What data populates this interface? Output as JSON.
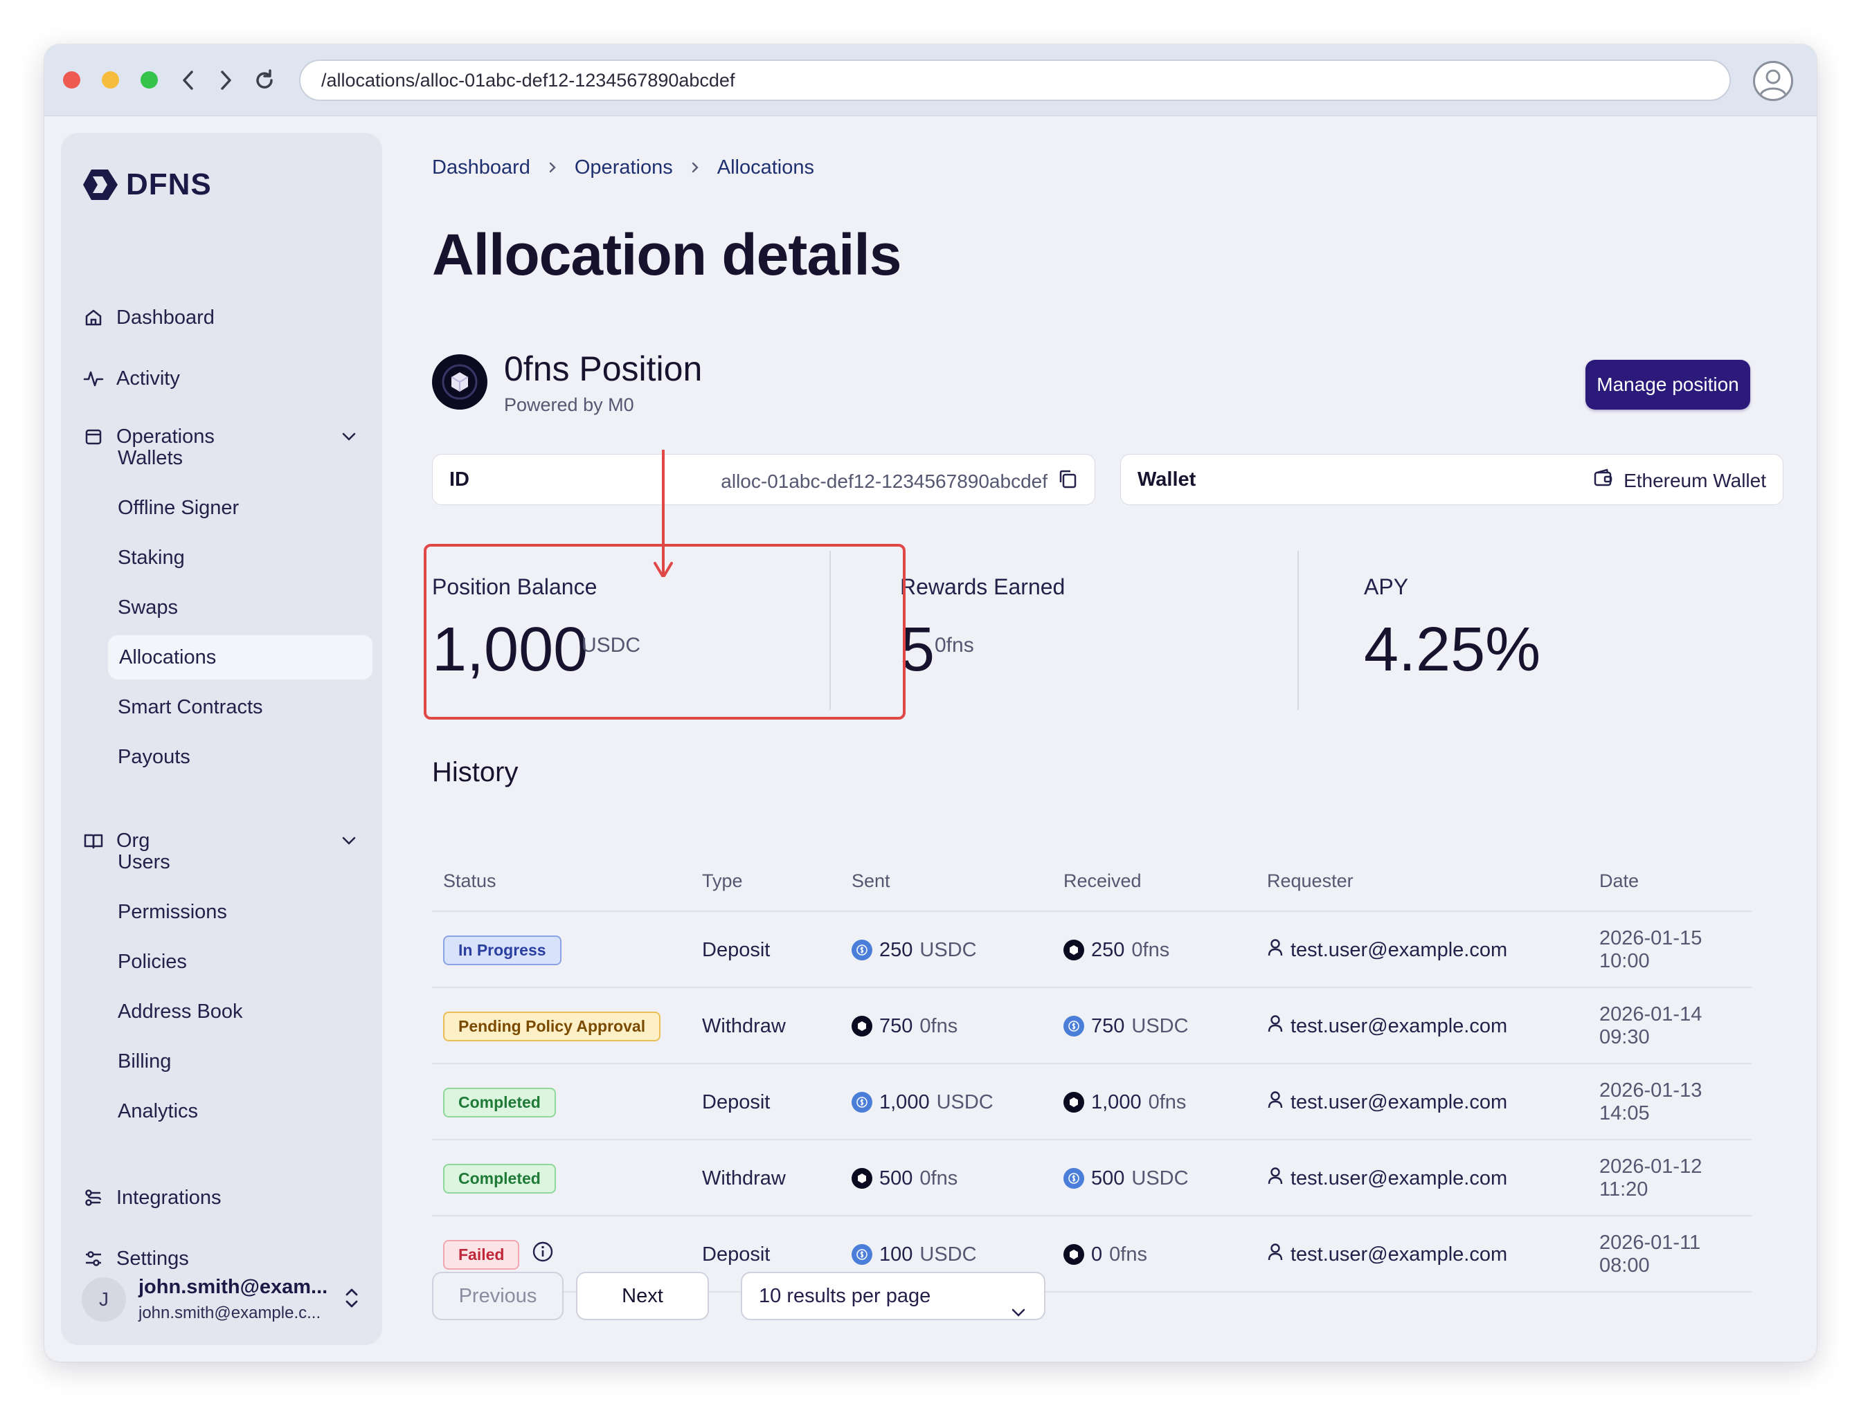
{
  "browser": {
    "url": "/allocations/alloc-01abc-def12-1234567890abcdef"
  },
  "sidebar": {
    "logo": "DFNS",
    "dashboard": "Dashboard",
    "activity": "Activity",
    "operations": "Operations",
    "operations_items": [
      "Wallets",
      "Offline Signer",
      "Staking",
      "Swaps",
      "Allocations",
      "Smart Contracts",
      "Payouts"
    ],
    "org": "Org",
    "org_items": [
      "Users",
      "Permissions",
      "Policies",
      "Address Book",
      "Billing",
      "Analytics"
    ],
    "integrations": "Integrations",
    "settings": "Settings",
    "user": {
      "initial": "J",
      "name": "john.smith@exam...",
      "email": "john.smith@example.c..."
    }
  },
  "breadcrumb": [
    "Dashboard",
    "Operations",
    "Allocations"
  ],
  "page_title": "Allocation details",
  "position": {
    "title": "0fns Position",
    "subtitle": "Powered by M0",
    "manage_label": "Manage position"
  },
  "id_card": {
    "label": "ID",
    "value": "alloc-01abc-def12-1234567890abcdef"
  },
  "wallet_card": {
    "label": "Wallet",
    "value": "Ethereum Wallet"
  },
  "stats": {
    "balance": {
      "label": "Position Balance",
      "value": "1,000",
      "unit": "USDC"
    },
    "rewards": {
      "label": "Rewards Earned",
      "value": "5",
      "unit": "0fns"
    },
    "apy": {
      "label": "APY",
      "value": "4.25%"
    }
  },
  "history": {
    "title": "History",
    "columns": [
      "Status",
      "Type",
      "Sent",
      "Received",
      "Requester",
      "Date"
    ],
    "rows": [
      {
        "status": "In Progress",
        "type": "Deposit",
        "sent_amount": "250",
        "sent_unit": "USDC",
        "received_amount": "250",
        "received_unit": "0fns",
        "requester": "test.user@example.com",
        "date": "2026-01-15 10:00"
      },
      {
        "status": "Pending Policy Approval",
        "type": "Withdraw",
        "sent_amount": "750",
        "sent_unit": "0fns",
        "received_amount": "750",
        "received_unit": "USDC",
        "requester": "test.user@example.com",
        "date": "2026-01-14 09:30"
      },
      {
        "status": "Completed",
        "type": "Deposit",
        "sent_amount": "1,000",
        "sent_unit": "USDC",
        "received_amount": "1,000",
        "received_unit": "0fns",
        "requester": "test.user@example.com",
        "date": "2026-01-13 14:05"
      },
      {
        "status": "Completed",
        "type": "Withdraw",
        "sent_amount": "500",
        "sent_unit": "0fns",
        "received_amount": "500",
        "received_unit": "USDC",
        "requester": "test.user@example.com",
        "date": "2026-01-12 11:20"
      },
      {
        "status": "Failed",
        "type": "Deposit",
        "sent_amount": "100",
        "sent_unit": "USDC",
        "received_amount": "0",
        "received_unit": "0fns",
        "requester": "test.user@example.com",
        "date": "2026-01-11 08:00"
      }
    ]
  },
  "pagination": {
    "previous": "Previous",
    "next": "Next",
    "per_page": "10 results per page"
  },
  "colors": {
    "accent": "#2c1a7a",
    "highlight": "#e04848",
    "in_progress": "#2a3fa0",
    "pending": "#7a4a00",
    "completed": "#1e7a36",
    "failed": "#c0283a"
  }
}
